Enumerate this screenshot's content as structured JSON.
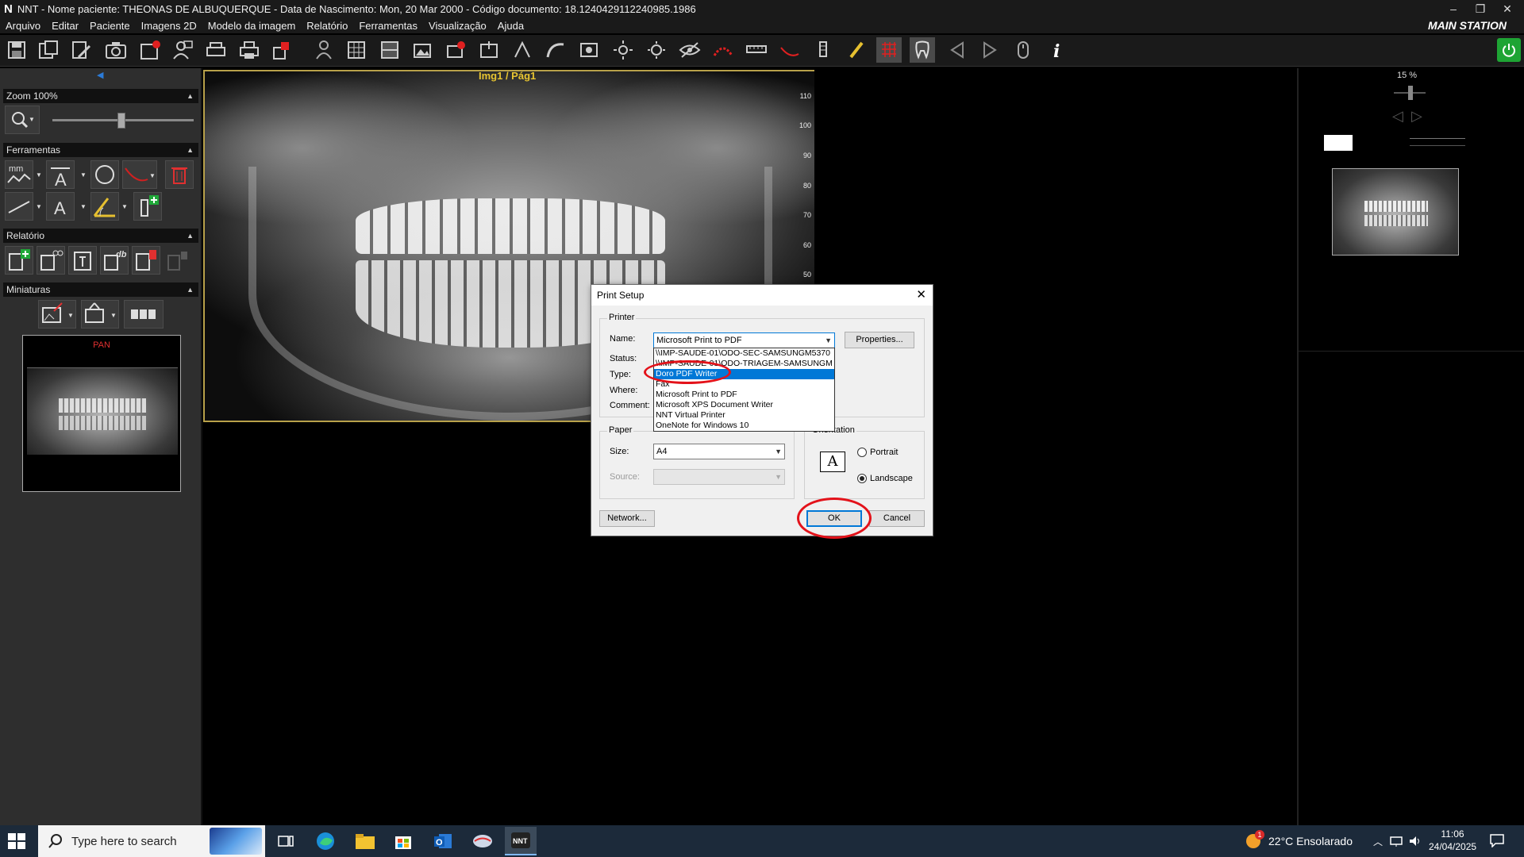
{
  "window": {
    "title": "NNT - Nome paciente: THEONAS DE ALBUQUERQUE - Data de Nascimento: Mon, 20 Mar 2000 - Código documento: 18.1240429112240985.1986",
    "app_logo": "N",
    "station": "MAIN STATION",
    "controls": [
      "–",
      "❐",
      "✕"
    ]
  },
  "menu": [
    "Arquivo",
    "Editar",
    "Paciente",
    "Imagens 2D",
    "Modelo da imagem",
    "Relatório",
    "Ferramentas",
    "Visualização",
    "Ajuda"
  ],
  "left_panel": {
    "zoom_header": "Zoom 100%",
    "tools_header": "Ferramentas",
    "tools_mm": "mm",
    "tools_text_a": "A",
    "report_header": "Relatório",
    "report_db": "db",
    "thumbs_header": "Miniaturas",
    "thumb_label": "PAN"
  },
  "image": {
    "label": "Img1 / Pág1",
    "ruler_ticks": [
      "110",
      "100",
      "90",
      "80",
      "70",
      "60",
      "50"
    ]
  },
  "right_panel": {
    "zoom_percent": "15 %"
  },
  "dialog": {
    "title": "Print Setup",
    "printer_group": "Printer",
    "name_label": "Name:",
    "name_value": "Microsoft Print to PDF",
    "status_label": "Status:",
    "type_label": "Type:",
    "where_label": "Where:",
    "comment_label": "Comment:",
    "properties_button": "Properties...",
    "printer_options": [
      "\\\\IMP-SAUDE-01\\ODO-SEC-SAMSUNGM5370",
      "\\\\IMP-SAUDE-01\\ODO-TRIAGEM-SAMSUNGM",
      "Doro PDF Writer",
      "Fax",
      "Microsoft Print to PDF",
      "Microsoft XPS Document Writer",
      "NNT Virtual Printer",
      "OneNote for Windows 10"
    ],
    "selected_option_index": 2,
    "paper_group": "Paper",
    "size_label": "Size:",
    "size_value": "A4",
    "source_label": "Source:",
    "orientation_group": "Orientation",
    "portrait_label": "Portrait",
    "landscape_label": "Landscape",
    "orientation_selected": "Landscape",
    "orientation_icon_letter": "A",
    "network_button": "Network...",
    "ok_button": "OK",
    "cancel_button": "Cancel"
  },
  "taskbar": {
    "search_placeholder": "Type here to search",
    "weather": "22°C  Ensolarado",
    "weather_badge": "1",
    "time": "11:06",
    "date": "24/04/2025"
  },
  "colors": {
    "accent_blue": "#0078d7",
    "annotation_red": "#e3121a",
    "power_green": "#1ea434",
    "image_label_yellow": "#e7c431"
  }
}
